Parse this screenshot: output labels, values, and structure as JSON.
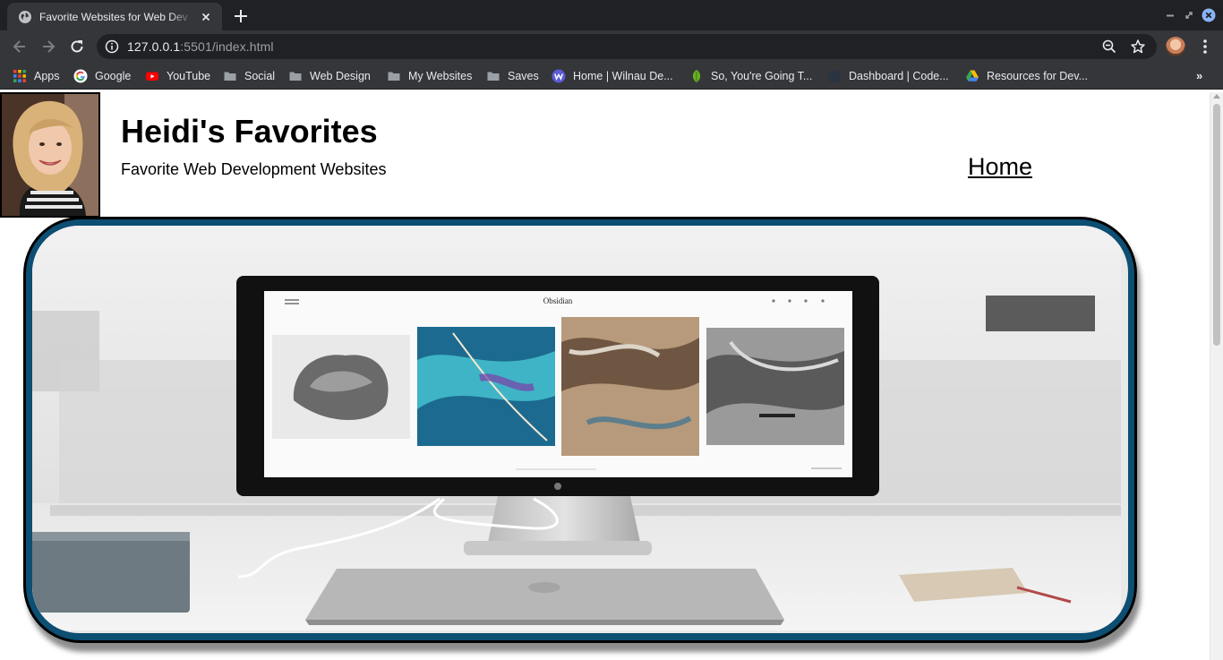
{
  "browser": {
    "tab_title": "Favorite Websites for Web Dev",
    "url_host": "127.0.0.1",
    "url_path": ":5501/index.html"
  },
  "bookmarks": [
    {
      "label": "Apps",
      "icon": "apps-grid-icon"
    },
    {
      "label": "Google",
      "icon": "google-icon"
    },
    {
      "label": "YouTube",
      "icon": "youtube-icon"
    },
    {
      "label": "Social",
      "icon": "folder-icon"
    },
    {
      "label": "Web Design",
      "icon": "folder-icon"
    },
    {
      "label": "My Websites",
      "icon": "folder-icon"
    },
    {
      "label": "Saves",
      "icon": "folder-icon"
    },
    {
      "label": "Home | Wilnau De...",
      "icon": "wilnau-icon"
    },
    {
      "label": "So, You're Going T...",
      "icon": "leaf-icon"
    },
    {
      "label": "Dashboard | Code...",
      "icon": "codecademy-icon"
    },
    {
      "label": "Resources for Dev...",
      "icon": "google-drive-icon"
    }
  ],
  "page": {
    "title": "Heidi's Favorites",
    "subtitle": "Favorite Web Development Websites",
    "nav_home": "Home"
  },
  "hero": {
    "screen_brand": "Obsidian"
  },
  "colors": {
    "frame_accent": "#0d4e73",
    "chrome_dark": "#202124",
    "chrome_toolbar": "#35363a"
  }
}
